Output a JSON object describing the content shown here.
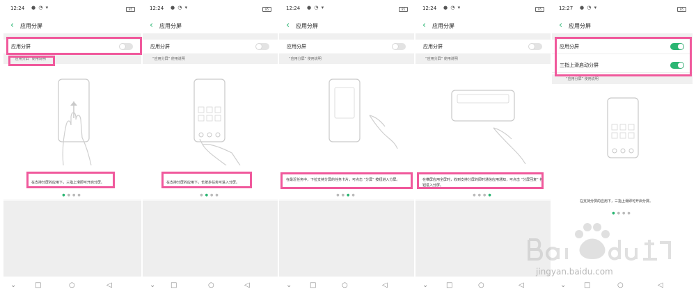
{
  "screens": [
    {
      "status_time": "12:24",
      "title": "应用分屏",
      "rows": [
        {
          "label": "应用分屏",
          "on": false
        }
      ],
      "hint": "“应用分屏” 使用说明",
      "caption": "在支持分屏的应用下，三指上滑即可开启分屏。"
    },
    {
      "status_time": "12:24",
      "title": "应用分屏",
      "rows": [
        {
          "label": "应用分屏",
          "on": false
        }
      ],
      "hint": "“应用分屏” 使用说明",
      "caption": "在支持分屏的应用下，长按多任务可进入分屏。"
    },
    {
      "status_time": "12:24",
      "title": "应用分屏",
      "rows": [
        {
          "label": "应用分屏",
          "on": false
        }
      ],
      "hint": "“应用分屏” 使用说明",
      "caption": "在最近任务中，下拉支持分屏的任务卡片，可点击 “分屏” 按钮进入分屏。"
    },
    {
      "status_time": "12:24",
      "title": "应用分屏",
      "rows": [
        {
          "label": "应用分屏",
          "on": false
        }
      ],
      "hint": "“应用分屏” 使用说明",
      "caption": "在横屏应用全屏时，收到支持分屏的即时通信应用通知，可点击 “分屏回复” 按钮进入分屏。"
    },
    {
      "status_time": "12:27",
      "title": "应用分屏",
      "rows": [
        {
          "label": "应用分屏",
          "on": true
        },
        {
          "label": "三指上滑启动分屏",
          "on": true
        }
      ],
      "hint": "“应用分屏” 使用说明",
      "caption": "在支持分屏的应用下，三指上滑即可开启分屏。"
    }
  ],
  "icons": {
    "back": "chevron-left-icon",
    "nav": [
      "chevron-down-icon",
      "square-recents-icon",
      "circle-home-icon",
      "triangle-back-icon"
    ]
  },
  "watermark": {
    "text": "jingyan.baidu.com"
  },
  "colors": {
    "accent": "#2bb673",
    "highlight": "#f0599c"
  }
}
